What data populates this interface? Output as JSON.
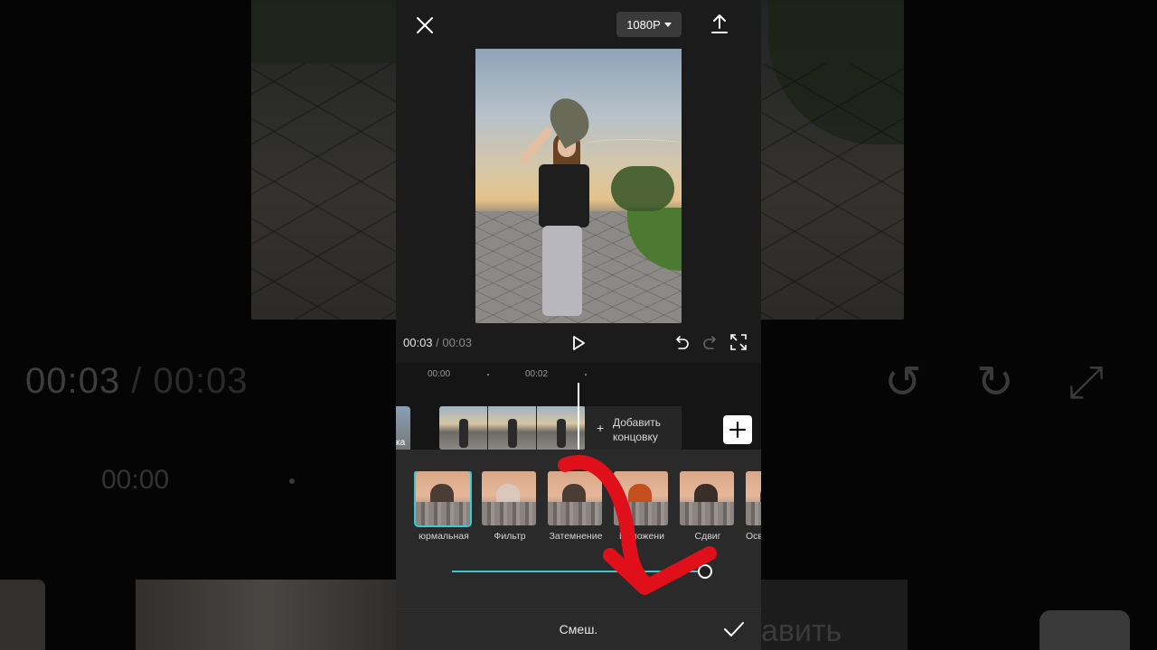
{
  "background": {
    "time_current": "00:03",
    "time_sep": " / ",
    "time_total": "00:03",
    "ruler_start": "00:00",
    "add_ending_fragment": "авить"
  },
  "topbar": {
    "close_icon": "close-icon",
    "resolution": "1080P",
    "export_icon": "export-icon"
  },
  "player": {
    "time_current": "00:03",
    "time_sep": " / ",
    "time_total": "00:03",
    "icons": [
      "play-icon",
      "undo-icon",
      "redo-icon",
      "fullscreen-icon"
    ]
  },
  "timeline": {
    "ruler": [
      "00:00",
      "00:02"
    ],
    "left_clip_label": "ка",
    "add_ending": {
      "line1": "Добавить",
      "line2": "концовку"
    },
    "add_track_icon": "plus-icon"
  },
  "blend": {
    "modes": [
      {
        "label": "Нормальная",
        "label_visible": "юрмальная",
        "selected": true
      },
      {
        "label": "Фильтр"
      },
      {
        "label": "Затемнение"
      },
      {
        "label": "Наложение",
        "label_visible": "Наложени"
      },
      {
        "label": "Сдвиг"
      },
      {
        "label": "Осветление",
        "label_visible": "Осв"
      }
    ],
    "slider_value": 1.0,
    "accent_color": "#3ec8cf"
  },
  "bottombar": {
    "title": "Смеш.",
    "confirm_icon": "check-icon"
  },
  "annotation": {
    "arrow_color": "#e0101a"
  }
}
